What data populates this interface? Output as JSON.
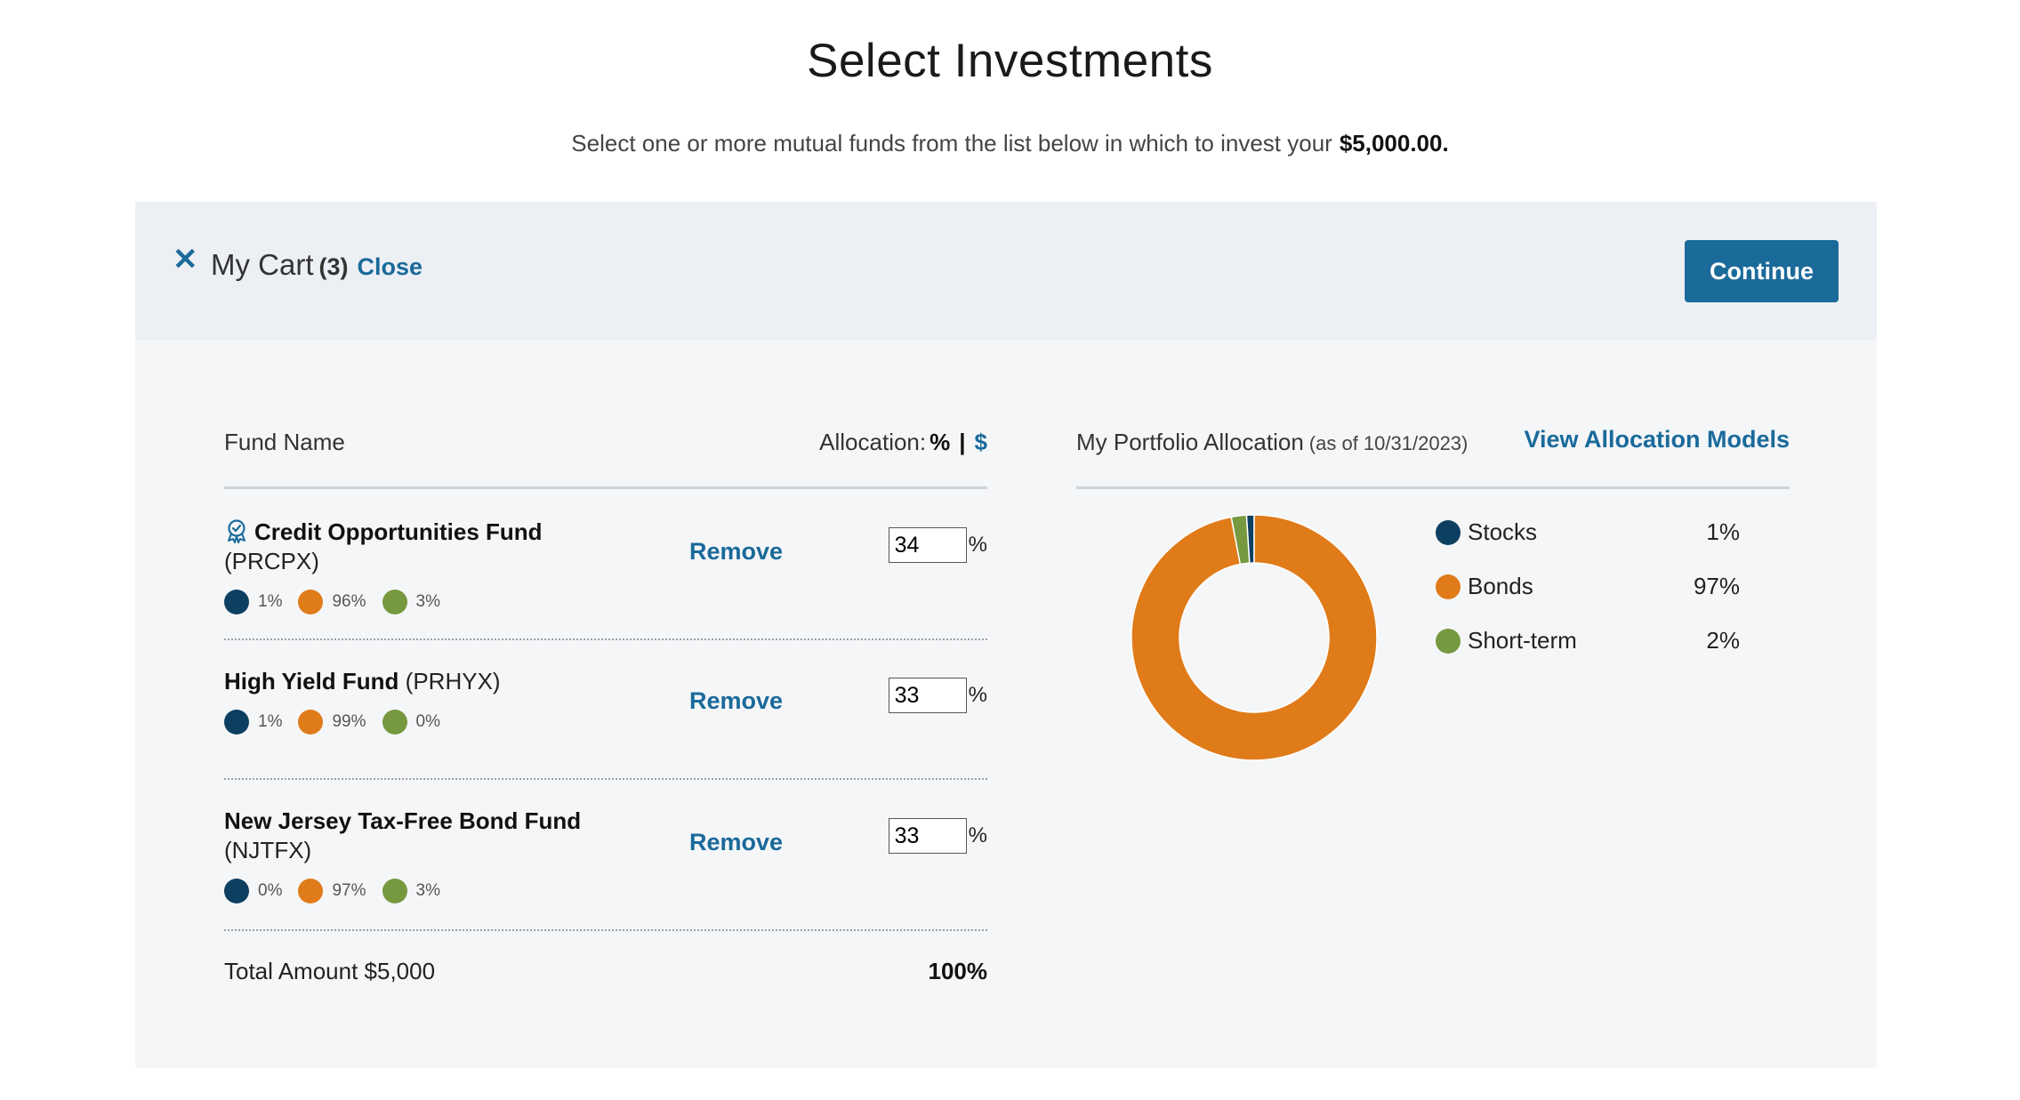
{
  "page": {
    "title": "Select Investments",
    "subtitle": "Select one or more mutual funds from the list below in which to invest your",
    "amount": "$5,000.00."
  },
  "cart": {
    "title": "My Cart",
    "count": "(3)",
    "close_label": "Close",
    "continue_label": "Continue"
  },
  "table": {
    "fund_name_header": "Fund Name",
    "allocation_header": "Allocation:",
    "pct_toggle": "%",
    "separator": "|",
    "dollar_toggle": "$",
    "remove_label": "Remove",
    "percent_sign": "%",
    "funds": [
      {
        "name": "Credit Opportunities Fund",
        "ticker": "(PRCPX)",
        "stocks": "1%",
        "bonds": "96%",
        "short_term": "3%",
        "allocation": "34"
      },
      {
        "name": "High Yield Fund",
        "ticker": "(PRHYX)",
        "stocks": "1%",
        "bonds": "99%",
        "short_term": "0%",
        "allocation": "33"
      },
      {
        "name": "New Jersey Tax-Free Bond Fund",
        "ticker": "(NJTFX)",
        "stocks": "0%",
        "bonds": "97%",
        "short_term": "3%",
        "allocation": "33"
      }
    ],
    "total_label": "Total Amount $5,000",
    "total_pct": "100%"
  },
  "portfolio": {
    "title": "My Portfolio Allocation",
    "as_of": "(as of 10/31/2023)",
    "view_models_label": "View Allocation Models",
    "legend": [
      {
        "name": "Stocks",
        "value": "1%"
      },
      {
        "name": "Bonds",
        "value": "97%"
      },
      {
        "name": "Short-term",
        "value": "2%"
      }
    ]
  },
  "chart_data": {
    "type": "pie",
    "categories": [
      "Stocks",
      "Bonds",
      "Short-term"
    ],
    "values": [
      1,
      97,
      2
    ],
    "colors": [
      "#0d3f61",
      "#e07b1a",
      "#76993f"
    ],
    "donut": true
  },
  "colors": {
    "accent": "#1a6a9a",
    "stocks": "#0d3f61",
    "bonds": "#e07b1a",
    "short_term": "#76993f"
  },
  "icons": {
    "badge": "award-ribbon-icon",
    "close": "close-icon"
  }
}
